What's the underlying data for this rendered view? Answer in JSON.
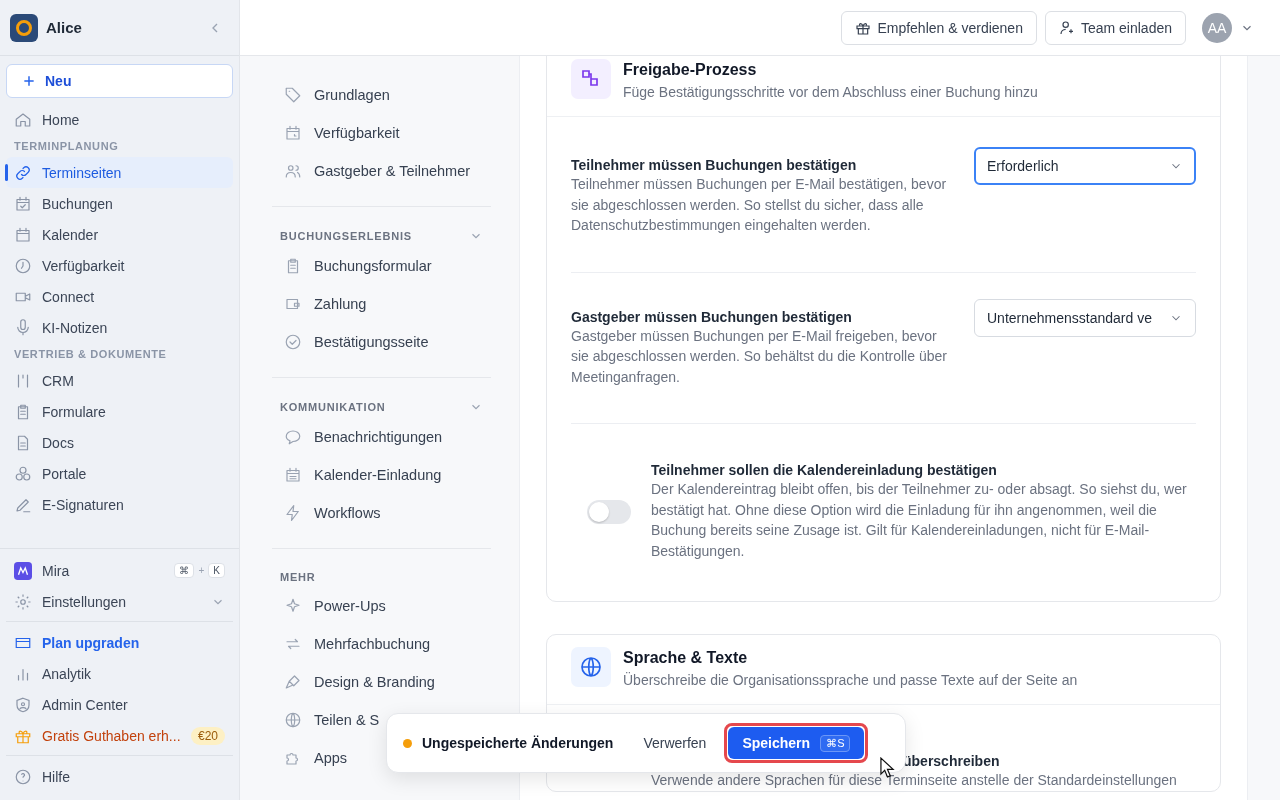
{
  "sidebar": {
    "workspace": "Alice",
    "new_button": "Neu",
    "nav": [
      {
        "kind": "item",
        "label": "Home",
        "selected": false
      },
      {
        "kind": "header",
        "label": "TERMINPLANUNG"
      },
      {
        "kind": "item",
        "label": "Terminseiten",
        "selected": true
      },
      {
        "kind": "item",
        "label": "Buchungen",
        "selected": false
      },
      {
        "kind": "item",
        "label": "Kalender",
        "selected": false
      },
      {
        "kind": "item",
        "label": "Verfügbarkeit",
        "selected": false
      },
      {
        "kind": "item",
        "label": "Connect",
        "selected": false
      },
      {
        "kind": "item",
        "label": "KI-Notizen",
        "selected": false
      },
      {
        "kind": "header",
        "label": "VERTRIEB & DOKUMENTE"
      },
      {
        "kind": "item",
        "label": "CRM",
        "selected": false
      },
      {
        "kind": "item",
        "label": "Formulare",
        "selected": false
      },
      {
        "kind": "item",
        "label": "Docs",
        "selected": false
      },
      {
        "kind": "item",
        "label": "Portale",
        "selected": false
      },
      {
        "kind": "item",
        "label": "E-Signaturen",
        "selected": false
      }
    ],
    "assistant": {
      "label": "Mira",
      "keys": [
        "⌘",
        "K"
      ],
      "joiner": "+"
    },
    "settings": {
      "label": "Einstellungen",
      "expanded": false
    },
    "footer": [
      {
        "kind": "upgrade",
        "label": "Plan upgraden"
      },
      {
        "kind": "item",
        "label": "Analytik"
      },
      {
        "kind": "item",
        "label": "Admin Center"
      },
      {
        "kind": "promo",
        "label": "Gratis Guthaben erh...",
        "badge": "€20"
      }
    ],
    "help": "Hilfe"
  },
  "topbar": {
    "buttons": [
      "Empfehlen & verdienen",
      "Team einladen"
    ],
    "avatar": "AA"
  },
  "subnav": [
    {
      "items": [
        "Grundlagen",
        "Verfügbarkeit",
        "Gastgeber & Teilnehmer"
      ]
    },
    {
      "title": "BUCHUNGSERLEBNIS",
      "expanded": true,
      "items": [
        "Buchungsformular",
        "Zahlung",
        "Bestätigungsseite"
      ]
    },
    {
      "title": "KOMMUNIKATION",
      "expanded": true,
      "items": [
        "Benachrichtigungen",
        "Kalender-Einladung",
        "Workflows"
      ]
    },
    {
      "title": "MEHR",
      "items": [
        "Power-Ups",
        "Mehrfachbuchung",
        "Design & Branding",
        "Teilen & S",
        "Apps"
      ]
    }
  ],
  "cards": [
    {
      "title": "Freigabe-Prozess",
      "subtitle": "Füge Bestätigungsschritte vor dem Abschluss einer Buchung hinzu",
      "settings": [
        {
          "kind": "select",
          "title": "Teilnehmer müssen Buchungen bestätigen",
          "description": "Teilnehmer müssen Buchungen per E-Mail bestätigen, bevor sie abgeschlossen werden. So stellst du sicher, dass alle Datenschutzbestimmungen eingehalten werden.",
          "value": "Erforderlich",
          "focused": true
        },
        {
          "kind": "select",
          "title": "Gastgeber müssen Buchungen bestätigen",
          "description": "Gastgeber müssen Buchungen per E-Mail freigeben, bevor sie abgeschlossen werden. So behältst du die Kontrolle über Meetinganfragen.",
          "value": "Unternehmensstandard ve",
          "focused": false
        },
        {
          "kind": "toggle",
          "title": "Teilnehmer sollen die Kalendereinladung bestätigen",
          "description": "Der Kalendereintrag bleibt offen, bis der Teilnehmer zu- oder absagt. So siehst du, wer bestätigt hat. Ohne diese Option wird die Einladung für ihn angenommen, weil die Buchung bereits seine Zusage ist. Gilt für Kalendereinladungen, nicht für E-Mail-Bestätigungen.",
          "on": false
        }
      ]
    },
    {
      "title": "Sprache & Texte",
      "subtitle": "Überschreibe die Organisationssprache und passe Texte auf der Seite an",
      "settings": [
        {
          "kind": "partial",
          "title": "überschreiben",
          "description": "Verwende andere Sprachen für diese Terminseite anstelle der Standardeinstellungen"
        }
      ]
    }
  ],
  "save_bar": {
    "status": "Ungespeicherte Änderungen",
    "discard": "Verwerfen",
    "save": "Speichern",
    "shortcut": "⌘S",
    "highlighted": true
  }
}
